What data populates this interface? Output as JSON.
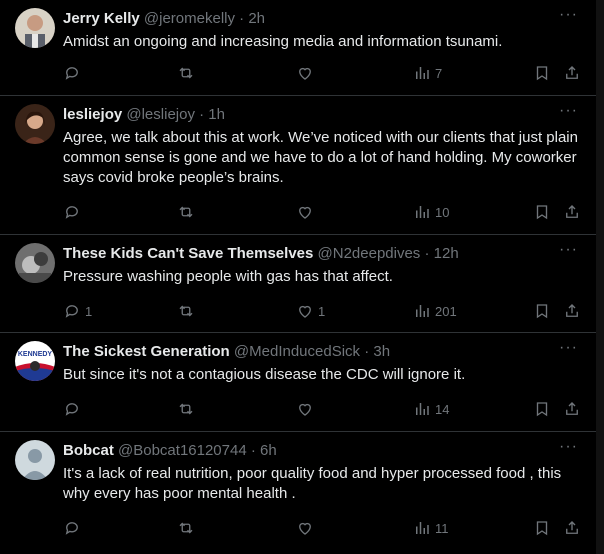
{
  "tweets": [
    {
      "name": "Jerry Kelly",
      "handle": "@jeromekelly · 2h",
      "text": "Amidst an ongoing and increasing media and information tsunami.",
      "replies": "",
      "retweets": "",
      "likes": "",
      "views": "7",
      "avatar": "jerry-avatar"
    },
    {
      "name": "lesliejoy",
      "handle": "@lesliejoy · 1h",
      "text": "Agree, we talk about this at work.  We’ve noticed with our clients that just plain common sense is gone and we have to do a lot of hand holding. My coworker says covid broke people’s brains.",
      "replies": "",
      "retweets": "",
      "likes": "",
      "views": "10",
      "avatar": "lesliejoy-avatar"
    },
    {
      "name": "These Kids Can't Save Themselves",
      "handle": "@N2deepdives · 12h",
      "text": "Pressure washing people with gas has that affect.",
      "replies": "1",
      "retweets": "",
      "likes": "1",
      "views": "201",
      "avatar": "kids-avatar"
    },
    {
      "name": "The Sickest Generation",
      "handle": "@MedInducedSick · 3h",
      "text": "But since it's not a contagious disease the CDC will ignore it.",
      "replies": "",
      "retweets": "",
      "likes": "",
      "views": "14",
      "avatar": "kennedy-avatar"
    },
    {
      "name": "Bobcat",
      "handle": "@Bobcat16120744 · 6h",
      "text": "It's a lack of real nutrition,  poor quality food and hyper processed food , this why every has poor mental health .",
      "replies": "",
      "retweets": "",
      "likes": "",
      "views": "11",
      "avatar": "default-avatar"
    }
  ],
  "more_label": "···",
  "avatar_logo_text": "KENNEDY",
  "colors": {
    "bg": "#000000",
    "text": "#e7e9ea",
    "muted": "#71767b",
    "divider": "#2f3336"
  }
}
